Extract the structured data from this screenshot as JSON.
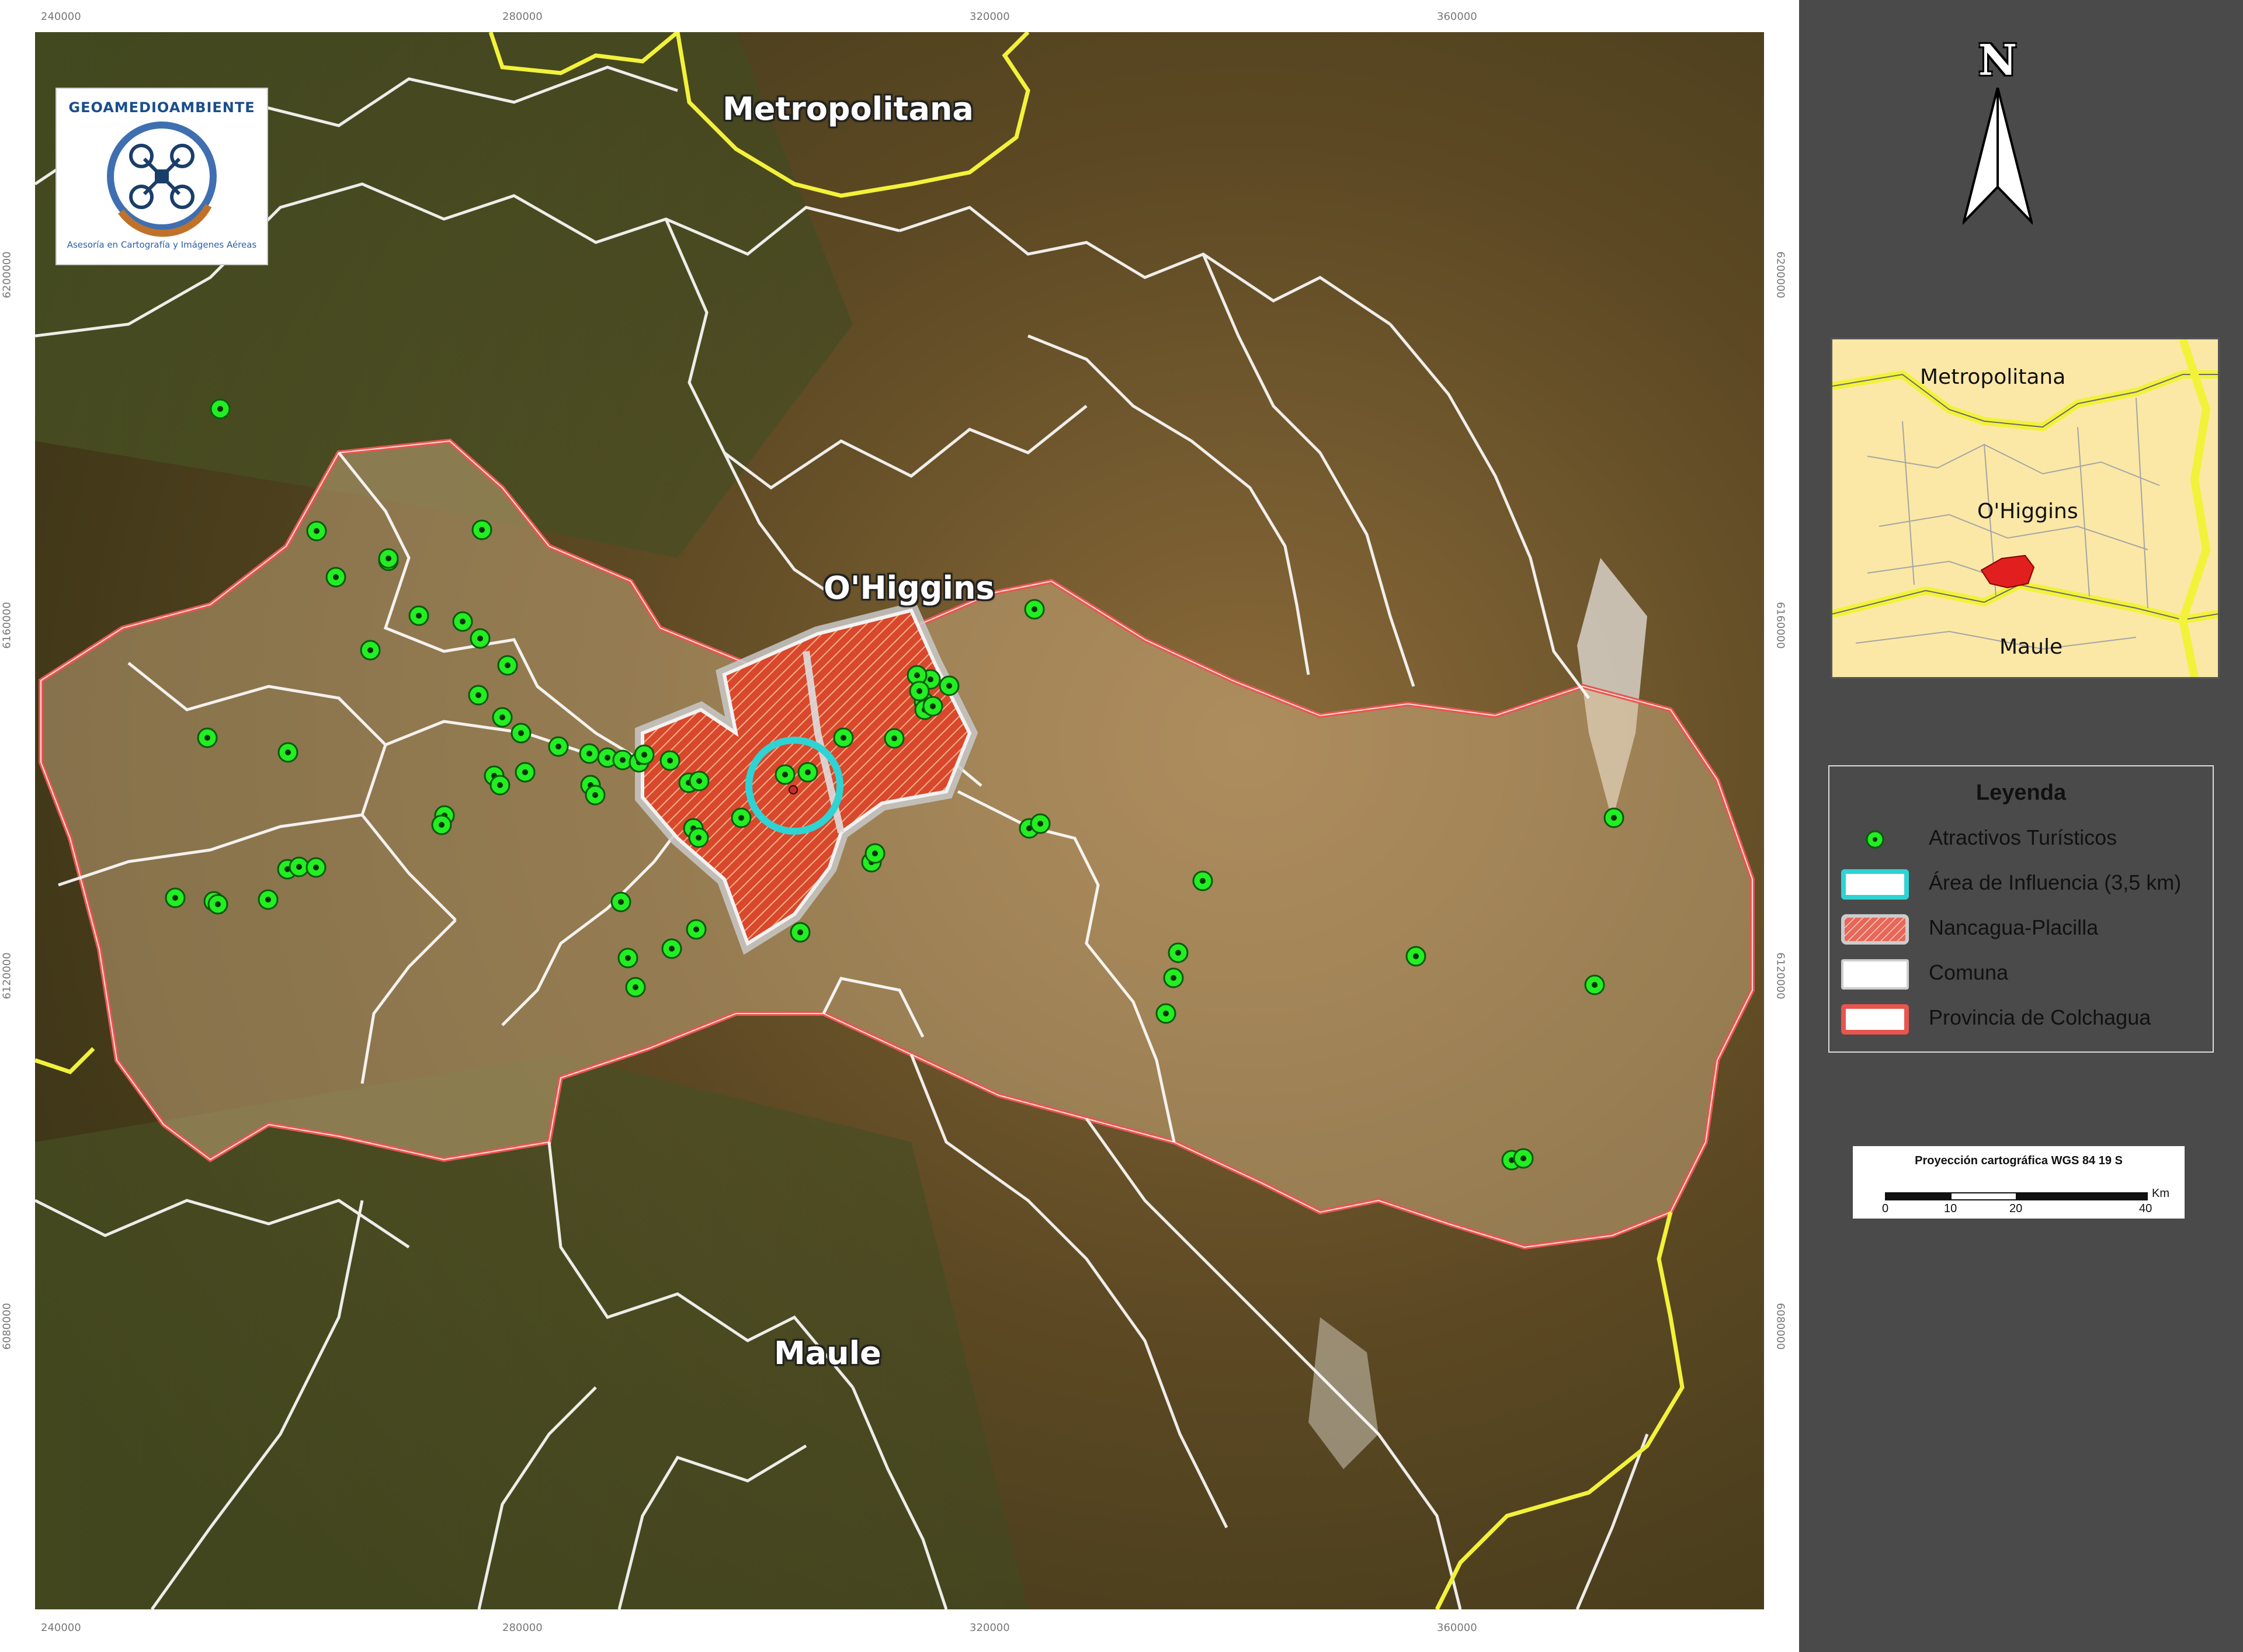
{
  "map": {
    "regions": {
      "metropolitana": "Metropolitana",
      "ohiggins": "O'Higgins",
      "maule": "Maule"
    },
    "colors": {
      "province_border": "#e8554e",
      "commune_border": "#ffffff",
      "region_border": "#f2f23a",
      "influence_area": "#2fd3d3",
      "study_area_fill": "#e0452c",
      "attraction": "#22ee22"
    },
    "ticks_top": [
      "240000",
      "280000",
      "320000",
      "360000"
    ],
    "ticks_bottom": [
      "240000",
      "280000",
      "320000",
      "360000"
    ],
    "ticks_left": [
      "6200000",
      "6160000",
      "6120000",
      "6080000"
    ],
    "ticks_right": [
      "6200000",
      "6160000",
      "6120000",
      "6080000"
    ]
  },
  "logo": {
    "title": "GEOAMEDIOAMBIENTE",
    "subtitle": "Asesoría en Cartografía y Imágenes Aéreas"
  },
  "north_arrow": {
    "letter": "N"
  },
  "inset": {
    "labels": {
      "metropolitana": "Metropolitana",
      "ohiggins": "O'Higgins",
      "maule": "Maule"
    }
  },
  "legend": {
    "title": "Leyenda",
    "items": [
      {
        "label": "Atractivos Turísticos",
        "icon": "green-dot-icon"
      },
      {
        "label": "Área de Influencia (3,5 km)",
        "icon": "cyan-box-icon"
      },
      {
        "label": "Nancagua-Placilla",
        "icon": "hatched-red-box-icon"
      },
      {
        "label": "Comuna",
        "icon": "white-box-icon"
      },
      {
        "label": "Provincia de Colchagua",
        "icon": "red-box-icon"
      }
    ]
  },
  "scale": {
    "title": "Proyección cartográfica WGS 84 19 S",
    "unit": "Km",
    "labels": [
      "0",
      "10",
      "20",
      "40"
    ]
  }
}
